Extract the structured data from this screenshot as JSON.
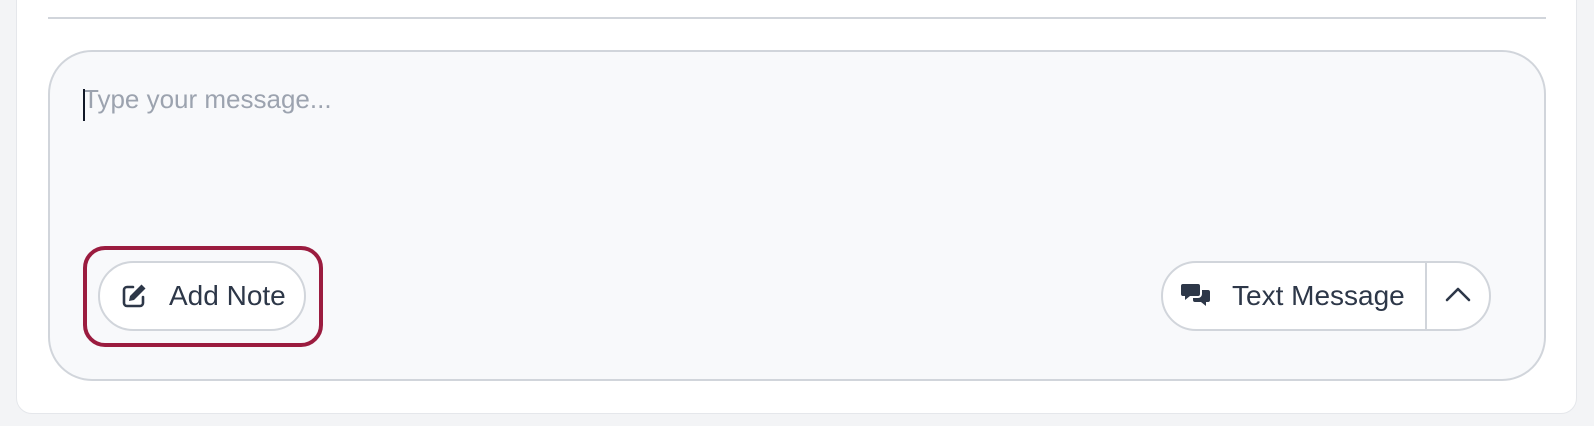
{
  "composer": {
    "placeholder": "Type your message...",
    "value": ""
  },
  "actions": {
    "add_note_label": "Add Note",
    "add_note_icon": "pencil-square-icon",
    "channel_label": "Text Message",
    "channel_icon": "chat-bubbles-icon",
    "channel_toggle_icon": "chevron-up-icon"
  },
  "colors": {
    "highlight_ring": "#9b1c3f",
    "button_text": "#2d3748",
    "border": "#d1d5db",
    "composer_bg": "#f8f9fb"
  }
}
